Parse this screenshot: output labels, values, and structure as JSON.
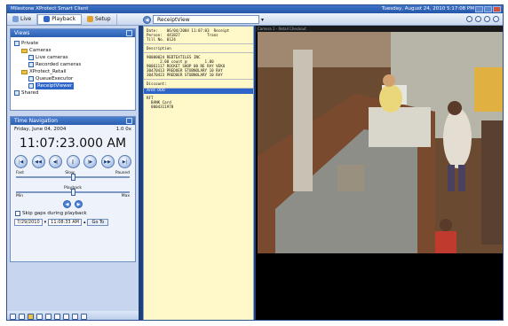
{
  "window": {
    "app_title": "Milestone XProtect Smart Client",
    "datetime": "Tuesday, August 24, 2010 5:17:08 PM"
  },
  "toolbar": {
    "tabs": [
      {
        "label": "Live"
      },
      {
        "label": "Playback"
      },
      {
        "label": "Setup"
      }
    ],
    "view_selector": "ReceiptView"
  },
  "views_panel": {
    "title": "Views",
    "tree": [
      {
        "label": "Private",
        "level": 0,
        "type": "root"
      },
      {
        "label": "Cameras",
        "level": 1,
        "type": "folder"
      },
      {
        "label": "Live cameras",
        "level": 2,
        "type": "view"
      },
      {
        "label": "Recorded cameras",
        "level": 2,
        "type": "view"
      },
      {
        "label": "XProtect_Retail",
        "level": 1,
        "type": "folder"
      },
      {
        "label": "QueueExecutor",
        "level": 2,
        "type": "view"
      },
      {
        "label": "ReceiptViewer",
        "level": 2,
        "type": "view",
        "selected": true
      },
      {
        "label": "Shared",
        "level": 0,
        "type": "root"
      }
    ]
  },
  "time_navigation": {
    "title": "Time Navigation",
    "date": "Friday, June 04, 2004",
    "speed": "1.0 0x",
    "time": "11:07:23.000 AM",
    "speed_slider": {
      "left": "Fast",
      "mid": "Slow",
      "right": "Paused",
      "sub_left": "Rev",
      "sub_right": "Fwd",
      "value": 0.5
    },
    "step_slider": {
      "left": "Min",
      "mid": "Playback",
      "right": "Max",
      "value": 0.5
    },
    "skip_gaps_label": "Skip gaps during playback",
    "goto_date": "7/29/2010",
    "goto_time": "11:08:33 AM",
    "goto_button": "Go To"
  },
  "receipt": {
    "header_lines": [
      "Date:    06/04/2004 11:07:03  Receipt",
      "Person:  441827            Trans",
      "Till No. 0124"
    ],
    "desc_title": "Description",
    "items": [
      "90000024 REDTEXTILES INC",
      "      2.00 count @        1.00",
      "90061117 ROCKET SHOP 00 RE RAY VEKO",
      "30470413 PREDUER STUBNOLARY 10 RAY",
      "30470423 PREDUER STUBNOLARY 10 RAY"
    ],
    "discount_label": "Discount:",
    "bar_label": "Amt: 000",
    "bottom_lines": [
      "RFT",
      "  BANK Card",
      "  0004311970"
    ]
  },
  "video": {
    "overlay": "Camera 1 - Retail Checkout"
  }
}
